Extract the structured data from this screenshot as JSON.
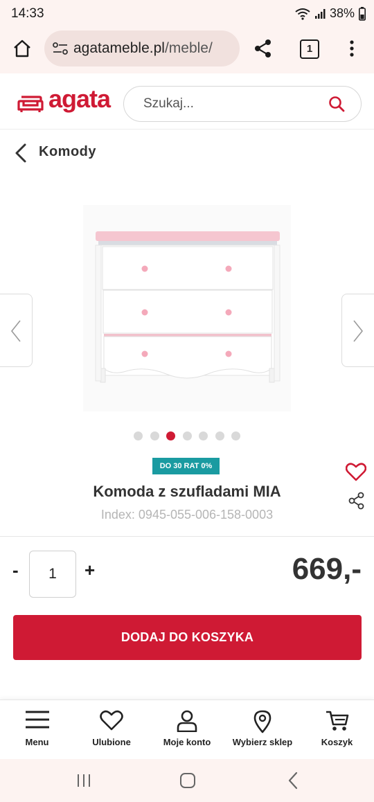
{
  "status_bar": {
    "time": "14:33",
    "battery": "38%"
  },
  "browser": {
    "url_domain": "agatameble.pl",
    "url_path": "/meble/",
    "tab_count": "1"
  },
  "header": {
    "logo_text": "agata",
    "search_placeholder": "Szukaj..."
  },
  "breadcrumb": {
    "label": "Komody"
  },
  "carousel": {
    "total_images": 7,
    "active_index": 2
  },
  "product": {
    "badge": "DO 30 RAT 0%",
    "title": "Komoda z szufladami MIA",
    "index": "Index: 0945-055-006-158-0003",
    "quantity": "1",
    "price": "669,-",
    "qty_minus": "-",
    "qty_plus": "+",
    "add_to_cart": "DODAJ DO KOSZYKA"
  },
  "bottom_nav": {
    "items": [
      {
        "label": "Menu",
        "icon": "menu-icon"
      },
      {
        "label": "Ulubione",
        "icon": "heart-icon"
      },
      {
        "label": "Moje konto",
        "icon": "user-icon"
      },
      {
        "label": "Wybierz sklep",
        "icon": "location-pin-icon"
      },
      {
        "label": "Koszyk",
        "icon": "cart-icon"
      }
    ]
  },
  "colors": {
    "brand": "#cf1a34",
    "badge": "#1a9ba1",
    "chrome_bg": "#fdf3f1"
  }
}
